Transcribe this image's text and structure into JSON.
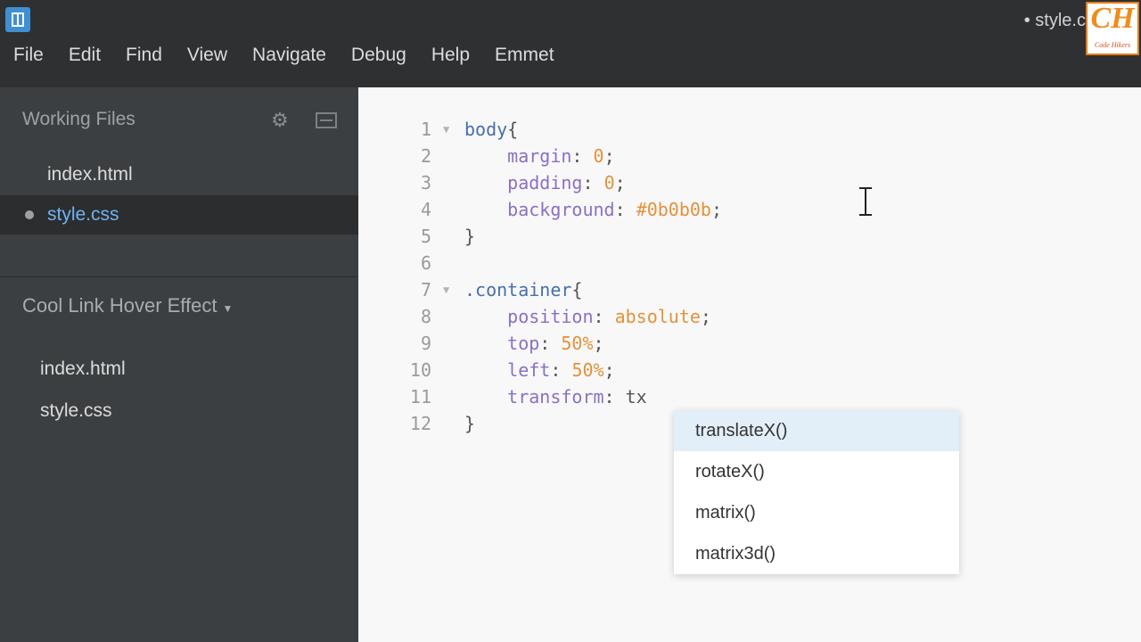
{
  "window": {
    "title": "• style.c",
    "logo_text": "CH",
    "logo_subtext": "Code Hikers"
  },
  "menu": [
    "File",
    "Edit",
    "Find",
    "View",
    "Navigate",
    "Debug",
    "Help",
    "Emmet"
  ],
  "sidebar": {
    "working_files_title": "Working Files",
    "working_files": [
      {
        "label": "index.html",
        "modified": false
      },
      {
        "label": "style.css",
        "modified": true
      }
    ],
    "project_title": "Cool Link Hover Effect",
    "project_files": [
      "index.html",
      "style.css"
    ]
  },
  "editor": {
    "lines": [
      {
        "n": "1",
        "fold": "▼",
        "parts": [
          [
            "sel",
            "body"
          ],
          [
            "br",
            "{"
          ]
        ]
      },
      {
        "n": "2",
        "fold": "",
        "parts": [
          [
            "txt",
            "    "
          ],
          [
            "prop",
            "margin"
          ],
          [
            "br",
            ": "
          ],
          [
            "val",
            "0"
          ],
          [
            "br",
            ";"
          ]
        ]
      },
      {
        "n": "3",
        "fold": "",
        "parts": [
          [
            "txt",
            "    "
          ],
          [
            "prop",
            "padding"
          ],
          [
            "br",
            ": "
          ],
          [
            "val",
            "0"
          ],
          [
            "br",
            ";"
          ]
        ]
      },
      {
        "n": "4",
        "fold": "",
        "parts": [
          [
            "txt",
            "    "
          ],
          [
            "prop",
            "background"
          ],
          [
            "br",
            ": "
          ],
          [
            "val",
            "#0b0b0b"
          ],
          [
            "br",
            ";"
          ]
        ]
      },
      {
        "n": "5",
        "fold": "",
        "parts": [
          [
            "br",
            "}"
          ]
        ]
      },
      {
        "n": "6",
        "fold": "",
        "parts": []
      },
      {
        "n": "7",
        "fold": "▼",
        "parts": [
          [
            "sel",
            ".container"
          ],
          [
            "br",
            "{"
          ]
        ]
      },
      {
        "n": "8",
        "fold": "",
        "parts": [
          [
            "txt",
            "    "
          ],
          [
            "prop",
            "position"
          ],
          [
            "br",
            ": "
          ],
          [
            "val",
            "absolute"
          ],
          [
            "br",
            ";"
          ]
        ]
      },
      {
        "n": "9",
        "fold": "",
        "parts": [
          [
            "txt",
            "    "
          ],
          [
            "prop",
            "top"
          ],
          [
            "br",
            ": "
          ],
          [
            "val",
            "50%"
          ],
          [
            "br",
            ";"
          ]
        ]
      },
      {
        "n": "10",
        "fold": "",
        "parts": [
          [
            "txt",
            "    "
          ],
          [
            "prop",
            "left"
          ],
          [
            "br",
            ": "
          ],
          [
            "val",
            "50%"
          ],
          [
            "br",
            ";"
          ]
        ]
      },
      {
        "n": "11",
        "fold": "",
        "parts": [
          [
            "txt",
            "    "
          ],
          [
            "prop",
            "transform"
          ],
          [
            "br",
            ": tx"
          ]
        ]
      },
      {
        "n": "12",
        "fold": "",
        "parts": [
          [
            "br",
            "}"
          ]
        ]
      }
    ]
  },
  "code_hints": [
    "translateX()",
    "rotateX()",
    "matrix()",
    "matrix3d()"
  ],
  "code_hints_selected": 0,
  "colors": {
    "selector": "#476fac",
    "property": "#8c6fc4",
    "value": "#e5913a",
    "hint_highlight": "#e2eef8"
  }
}
